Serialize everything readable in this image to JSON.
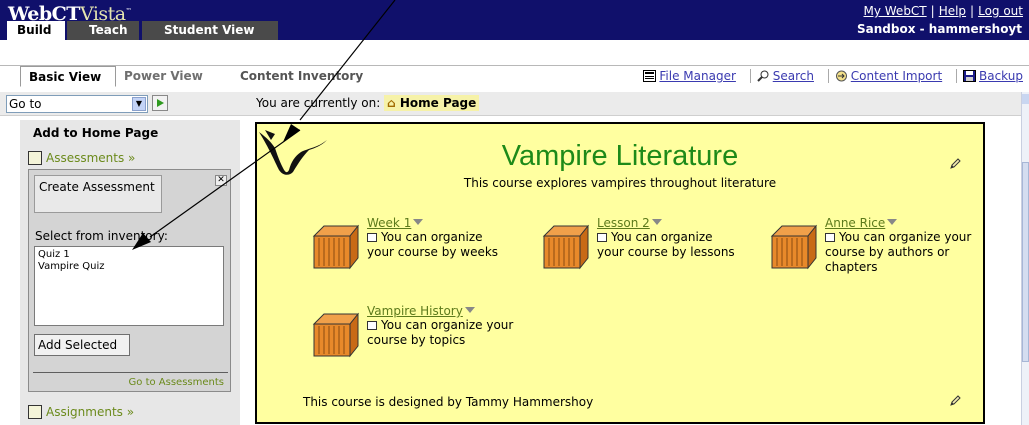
{
  "header": {
    "logo": {
      "brand": "WebCT",
      "product": "Vista",
      "tm": "™"
    },
    "links": [
      "My WebCT",
      "Help",
      "Log out"
    ],
    "course_name": "Sandbox - hammershoyt",
    "tabs": [
      "Build",
      "Teach",
      "Student View"
    ]
  },
  "subnav": {
    "tabs": [
      "Basic View",
      "Power View",
      "Content Inventory"
    ],
    "tools": [
      {
        "label": "File Manager",
        "icon": "file-manager-icon"
      },
      {
        "label": "Search",
        "icon": "search-icon"
      },
      {
        "label": "Content Import",
        "icon": "content-import-icon"
      },
      {
        "label": "Backup",
        "icon": "backup-icon"
      }
    ]
  },
  "gotobar": {
    "select_value": "Go to",
    "location_prefix": "You are currently on:",
    "location": "Home Page"
  },
  "left_panel": {
    "title": "Add to Home Page",
    "assessments_link": "Assessments »",
    "create_button": "Create Assessment",
    "close_label": "✕",
    "select_label": "Select from inventory:",
    "inventory": [
      "Quiz 1",
      "Vampire Quiz"
    ],
    "add_button": "Add Selected",
    "goto_link": "Go to Assessments",
    "assignments_link": "Assignments »"
  },
  "main": {
    "title": "Vampire Literature",
    "description": "This course explores vampires throughout literature",
    "folders": [
      {
        "title": "Week 1",
        "description": "You can organize your course by weeks"
      },
      {
        "title": "Lesson 2",
        "description": "You can organize your course by lessons"
      },
      {
        "title": "Anne Rice",
        "description": "You can organize your course by authors or chapters"
      },
      {
        "title": "Vampire History",
        "description": "You can organize your course by topics"
      }
    ],
    "footer": "This course is designed by Tammy Hammershoy"
  },
  "colors": {
    "header_blue": "#10106b",
    "content_yellow": "#ffffa0",
    "title_green": "#1d8a19",
    "link_green": "#5c7a1c",
    "folder_orange": "#e8892a"
  }
}
